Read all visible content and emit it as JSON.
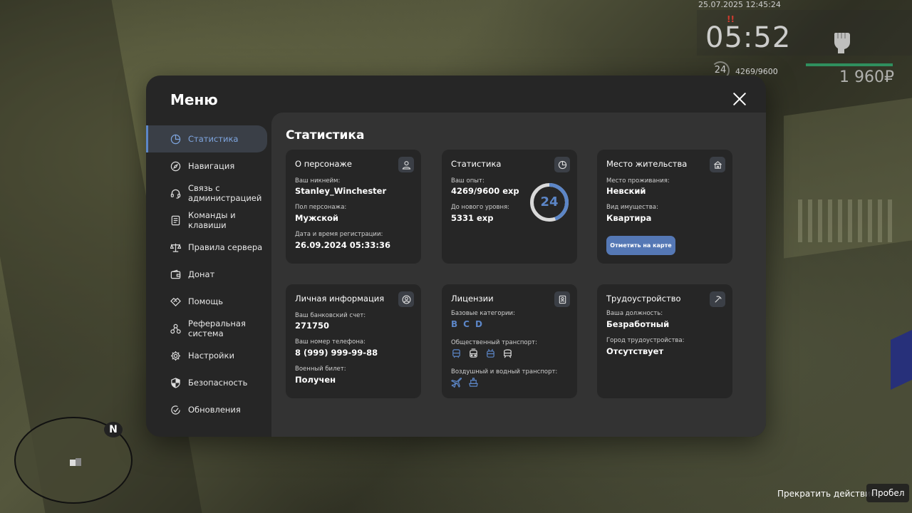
{
  "hud": {
    "datetime": "25.07.2025 12:45:24",
    "flag": "!!",
    "time": "05:52",
    "level": "24",
    "exp": "4269/9600",
    "money": "1 960₽"
  },
  "minimap": {
    "north_label": "N"
  },
  "bottom": {
    "stop_action": "Прекратить действие",
    "key_label": "Пробел"
  },
  "menu": {
    "title": "Меню",
    "content_title": "Статистика",
    "sidebar": [
      {
        "label": "Статистика",
        "icon": "pie-chart-icon",
        "active": true
      },
      {
        "label": "Навигация",
        "icon": "compass-icon"
      },
      {
        "label": "Связь с администрацией",
        "icon": "headset-icon"
      },
      {
        "label": "Команды и клавиши",
        "icon": "document-icon"
      },
      {
        "label": "Правила сервера",
        "icon": "scales-icon"
      },
      {
        "label": "Донат",
        "icon": "wallet-icon"
      },
      {
        "label": "Помощь",
        "icon": "handshake-icon"
      },
      {
        "label": "Реферальная система",
        "icon": "network-icon"
      },
      {
        "label": "Настройки",
        "icon": "gear-icon"
      },
      {
        "label": "Безопасность",
        "icon": "shield-icon"
      },
      {
        "label": "Обновления",
        "icon": "check-circle-icon"
      }
    ],
    "cards": {
      "character": {
        "title": "О персонаже",
        "nickname_label": "Ваш никнейм:",
        "nickname": "Stanley_Winchester",
        "gender_label": "Пол персонажа:",
        "gender": "Мужской",
        "reg_label": "Дата и время регистрации:",
        "reg": "26.09.2024 05:33:36"
      },
      "stats": {
        "title": "Статистика",
        "exp_label": "Ваш опыт:",
        "exp": "4269/9600 exp",
        "next_label": "До нового уровня:",
        "next": "5331 exp",
        "level": "24",
        "progress": 0.4447
      },
      "residence": {
        "title": "Место жительства",
        "place_label": "Место проживания:",
        "place": "Невский",
        "property_label": "Вид имущества:",
        "property": "Квартира",
        "button": "Отметить на карте"
      },
      "personal": {
        "title": "Личная информация",
        "bank_label": "Ваш банковский счет:",
        "bank": "271750",
        "phone_label": "Ваш номер телефона:",
        "phone": "8 (999) 999-99-88",
        "military_label": "Военный билет:",
        "military": "Получен"
      },
      "licenses": {
        "title": "Лицензии",
        "base_label": "Базовые категории:",
        "categories": [
          "B",
          "C",
          "D"
        ],
        "public_label": "Общественный транспорт:",
        "air_label": "Воздушный и водный транспорт:"
      },
      "employment": {
        "title": "Трудоустройство",
        "position_label": "Ваша должность:",
        "position": "Безработный",
        "city_label": "Город трудоустройства:",
        "city": "Отсутствует"
      }
    }
  },
  "colors": {
    "accent": "#5c86c7",
    "button": "#5578b5",
    "panel": "#262626",
    "content": "#333333"
  }
}
